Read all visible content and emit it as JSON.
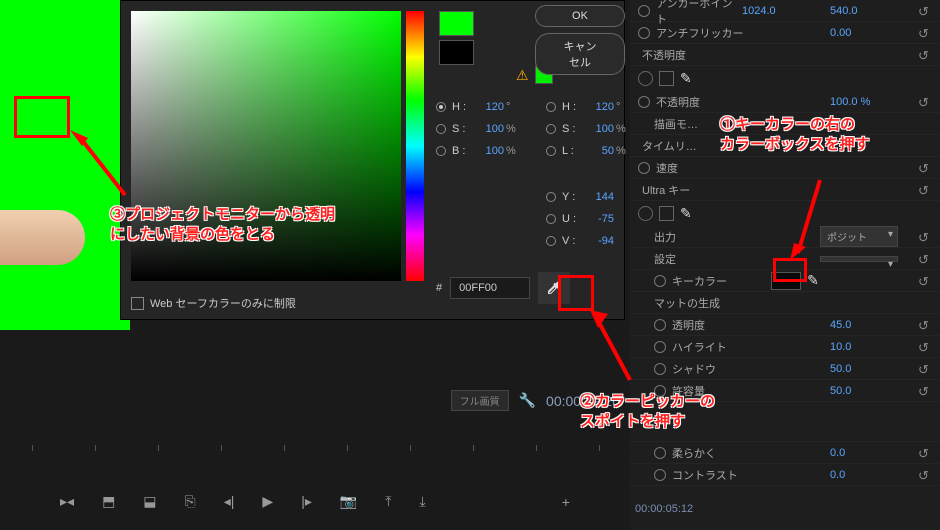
{
  "buttons": {
    "ok": "OK",
    "cancel": "キャンセル"
  },
  "hsv": {
    "h": {
      "label": "H :",
      "val": "120",
      "unit": "°"
    },
    "s": {
      "label": "S :",
      "val": "100",
      "unit": "%"
    },
    "b": {
      "label": "B :",
      "val": "100",
      "unit": "%"
    }
  },
  "hsl": {
    "h": {
      "label": "H :",
      "val": "120",
      "unit": "°"
    },
    "s": {
      "label": "S :",
      "val": "100",
      "unit": "%"
    },
    "l": {
      "label": "L :",
      "val": "50",
      "unit": "%"
    }
  },
  "yuv": {
    "y": {
      "label": "Y :",
      "val": "144"
    },
    "u": {
      "label": "U :",
      "val": "-75"
    },
    "v": {
      "label": "V :",
      "val": "-94"
    }
  },
  "hex": {
    "label": "#",
    "value": "00FF00"
  },
  "websafe": "Web セーフカラーのみに制限",
  "swatch_new": "#00ff00",
  "swatch_old": "#000000",
  "warn_swatch": "#00ee00",
  "effects": {
    "anchor": {
      "label": "アンカーポイント",
      "v1": "1024.0",
      "v2": "540.0"
    },
    "antiflicker": {
      "label": "アンチフリッカー",
      "val": "0.00"
    },
    "opacity_hdr": "不透明度",
    "speed": "速度",
    "opacity": {
      "label": "不透明度",
      "val": "100.0 %"
    },
    "drawmode": "描画モ…",
    "timeremap": "タイムリ…",
    "ultrakey": "Ultra キー",
    "output": {
      "label": "出力",
      "val": "ポジット"
    },
    "setting": {
      "label": "設定",
      "val": ""
    },
    "keycolor": "キーカラー",
    "mattegen": "マットの生成",
    "transparency": {
      "label": "透明度",
      "val": "45.0"
    },
    "highlight": {
      "label": "ハイライト",
      "val": "10.0"
    },
    "shadow": {
      "label": "シャドウ",
      "val": "50.0"
    },
    "tolerance": {
      "label": "許容量",
      "val": "50.0"
    },
    "soft": {
      "label": "柔らかく",
      "val": "0.0"
    },
    "contrast": {
      "label": "コントラスト",
      "val": "0.0"
    }
  },
  "timeline": {
    "full": "フル画質",
    "timecode": "00:00:19:20",
    "bottom_tc": "00:00:05:12"
  },
  "annotations": {
    "a1_l1": "①キーカラーの右の",
    "a1_l2": "カラーボックスを押す",
    "a2_l1": "②カラーピッカーの",
    "a2_l2": "スポイトを押す",
    "a3_l1": "③プロジェクトモニターから透明",
    "a3_l2": "にしたい背景の色をとる"
  }
}
